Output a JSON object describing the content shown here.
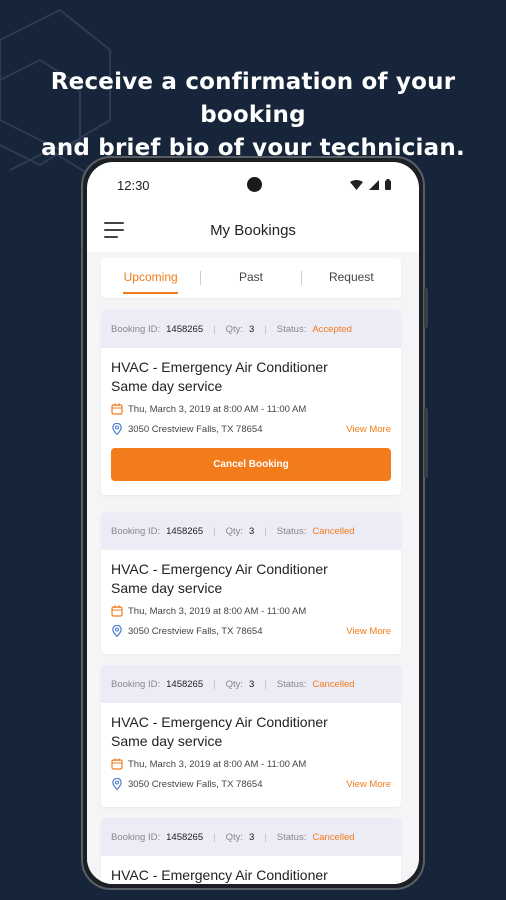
{
  "headline": {
    "line1": "Receive a confirmation of your booking",
    "line2": "and brief bio of your technician."
  },
  "status_bar": {
    "time": "12:30",
    "icons": [
      "wifi-icon",
      "signal-icon",
      "battery-icon"
    ]
  },
  "app_bar": {
    "title": "My Bookings",
    "menu_icon": "hamburger-menu-icon"
  },
  "tabs": [
    {
      "label": "Upcoming",
      "active": true
    },
    {
      "label": "Past",
      "active": false
    },
    {
      "label": "Request",
      "active": false
    }
  ],
  "labels": {
    "booking_id": "Booking ID:",
    "qty": "Qty:",
    "status": "Status:",
    "view_more": "View More",
    "cancel_booking": "Cancel Booking"
  },
  "bookings": [
    {
      "booking_id": "1458265",
      "qty": "3",
      "status": "Accepted",
      "title_line1": "HVAC - Emergency Air Conditioner",
      "title_line2": "Same day service",
      "datetime": "Thu, March 3, 2019 at 8:00 AM - 11:00 AM",
      "address": "3050 Crestview Falls, TX 78654"
    },
    {
      "booking_id": "1458265",
      "qty": "3",
      "status": "Cancelled",
      "title_line1": "HVAC - Emergency Air Conditioner",
      "title_line2": "Same day service",
      "datetime": "Thu, March 3, 2019 at 8:00 AM - 11:00 AM",
      "address": "3050 Crestview Falls, TX 78654"
    },
    {
      "booking_id": "1458265",
      "qty": "3",
      "status": "Cancelled",
      "title_line1": "HVAC - Emergency Air Conditioner",
      "title_line2": "Same day service",
      "datetime": "Thu, March 3, 2019 at 8:00 AM - 11:00 AM",
      "address": "3050 Crestview Falls, TX 78654"
    },
    {
      "booking_id": "1458265",
      "qty": "3",
      "status": "Cancelled",
      "title_line1": "HVAC - Emergency Air Conditioner"
    }
  ],
  "colors": {
    "background": "#17253a",
    "accent": "#f27b1a",
    "card_header": "#ececf6",
    "location_icon": "#4a7bd0"
  }
}
